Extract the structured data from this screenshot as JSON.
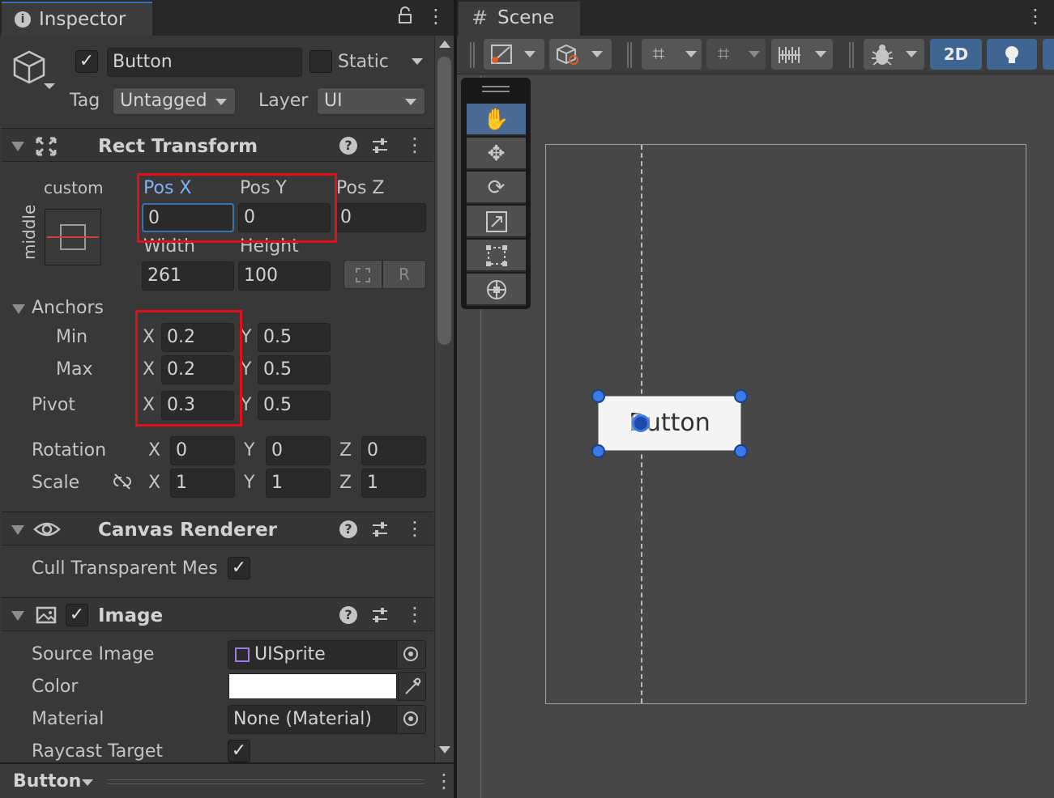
{
  "inspector": {
    "tab_title": "Inspector",
    "object": {
      "name": "Button",
      "static_label": "Static",
      "tag_label": "Tag",
      "tag_value": "Untagged",
      "layer_label": "Layer",
      "layer_value": "UI"
    },
    "rect_transform": {
      "title": "Rect Transform",
      "anchor_preset_label": "custom",
      "anchor_preset_side": "middle",
      "pos_x_label": "Pos X",
      "pos_y_label": "Pos Y",
      "pos_z_label": "Pos Z",
      "pos_x": "0",
      "pos_y": "0",
      "pos_z": "0",
      "width_label": "Width",
      "height_label": "Height",
      "width": "261",
      "height": "100",
      "r_button": "R",
      "anchors_label": "Anchors",
      "min_label": "Min",
      "max_label": "Max",
      "pivot_label": "Pivot",
      "x": "X",
      "y": "Y",
      "z": "Z",
      "min_x": "0.2",
      "min_y": "0.5",
      "max_x": "0.2",
      "max_y": "0.5",
      "pivot_x": "0.3",
      "pivot_y": "0.5",
      "rotation_label": "Rotation",
      "rot_x": "0",
      "rot_y": "0",
      "rot_z": "0",
      "scale_label": "Scale",
      "scale_x": "1",
      "scale_y": "1",
      "scale_z": "1"
    },
    "canvas_renderer": {
      "title": "Canvas Renderer",
      "cull_label": "Cull Transparent Mes"
    },
    "image": {
      "title": "Image",
      "source_image_label": "Source Image",
      "source_image_value": "UISprite",
      "color_label": "Color",
      "color_value": "#ffffff",
      "material_label": "Material",
      "material_value": "None (Material)",
      "raycast_label": "Raycast Target"
    },
    "footer_label": "Button"
  },
  "scene": {
    "tab_title": "Scene",
    "mode_2d": "2D",
    "button_text": "Button"
  },
  "colors": {
    "highlight_box": "#e0101a",
    "selection_handle": "#3a7be8",
    "active_label": "#7fb1f5"
  }
}
